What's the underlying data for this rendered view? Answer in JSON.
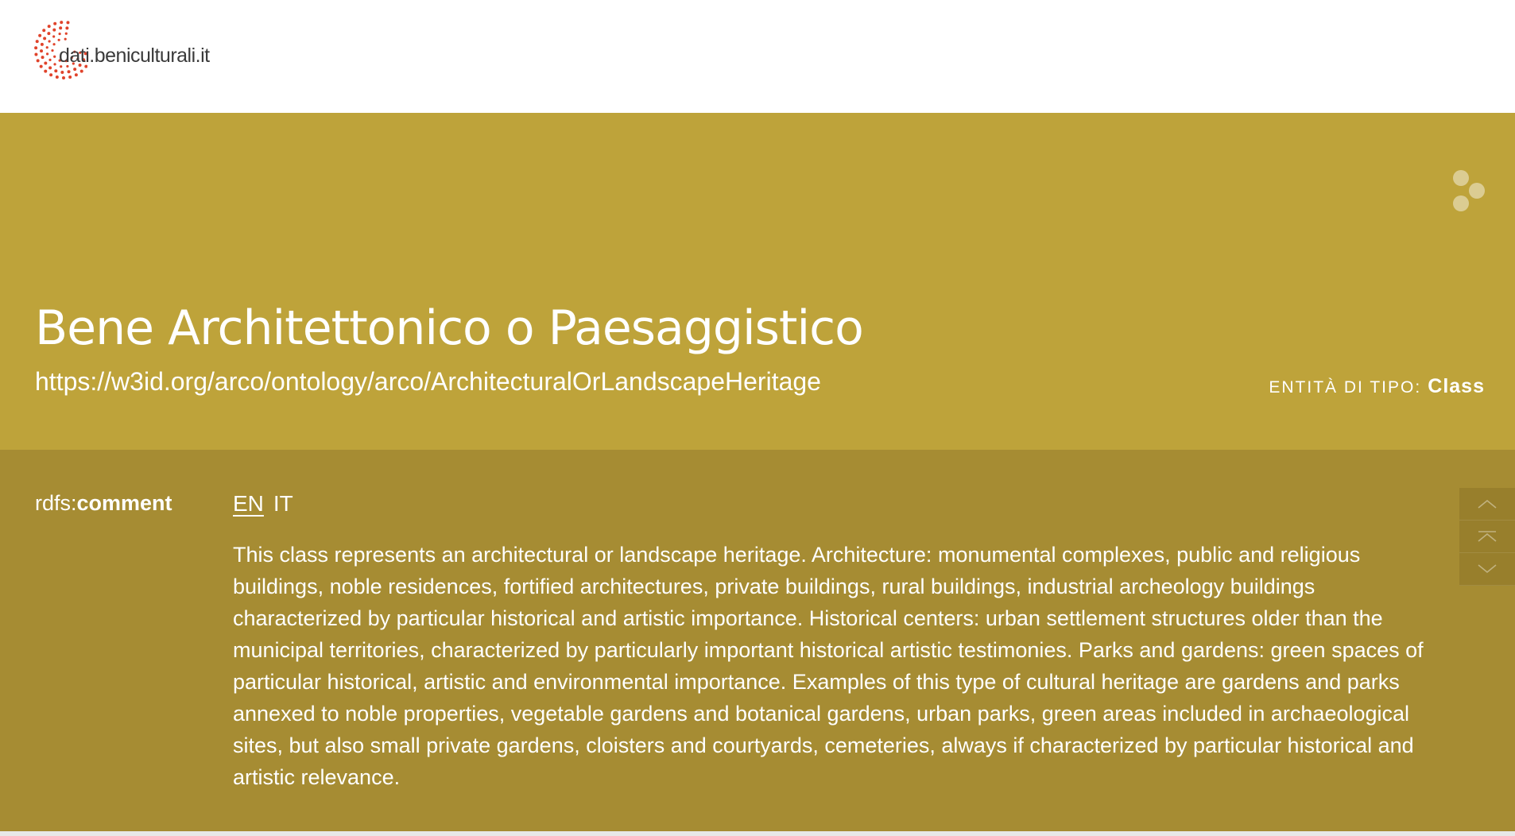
{
  "header": {
    "logo_text": "dati.beniculturali.it"
  },
  "hero": {
    "title": "Bene Architettonico o Paesaggistico",
    "uri": "https://w3id.org/arco/ontology/arco/ArchitecturalOrLandscapeHeritage",
    "entity_type_label": "ENTITÀ DI TIPO:",
    "entity_type_value": "Class",
    "share_icon": "share-dots-icon"
  },
  "properties": [
    {
      "prefix": "rdfs:",
      "name": "comment",
      "languages": [
        "EN",
        "IT"
      ],
      "active_language": "EN",
      "text": "This class represents an architectural or landscape heritage. Architecture: monumental complexes, public and religious buildings, noble residences, fortified architectures, private buildings, rural buildings, industrial archeology buildings characterized by particular historical and artistic importance. Historical centers: urban settlement structures older than the municipal territories, characterized by particularly important historical artistic testimonies. Parks and gardens: green spaces of particular historical, artistic and environmental importance. Examples of this type of cultural heritage are gardens and parks annexed to noble properties, vegetable gardens and botanical gardens, urban parks, green areas included in archaeological sites, but also small private gardens, cloisters and courtyards, cemeteries, always if characterized by particular historical and artistic relevance."
    }
  ],
  "scroll_nav": {
    "icons": [
      "chevron-up-icon",
      "scroll-top-icon",
      "chevron-down-icon"
    ]
  },
  "colors": {
    "hero_bg": "#bea33a",
    "section_bg": "#a68c33",
    "logo_accent": "#e0432b"
  }
}
